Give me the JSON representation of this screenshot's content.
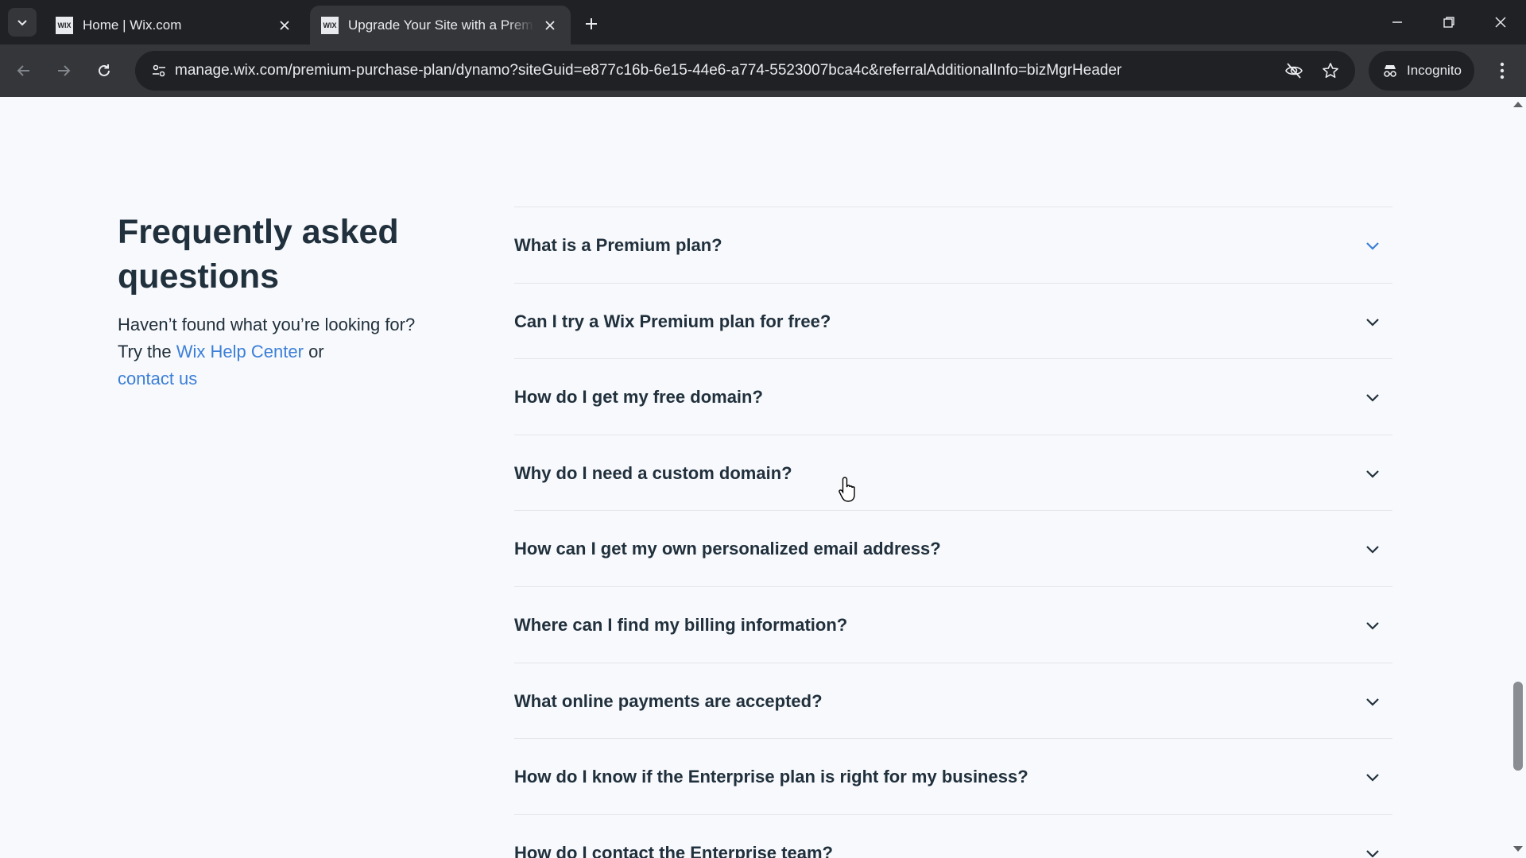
{
  "browser": {
    "tabs": [
      {
        "favicon": "WIX",
        "title": "Home | Wix.com",
        "active": false
      },
      {
        "favicon": "WIX",
        "title": "Upgrade Your Site with a Premium Plan",
        "active": true
      }
    ],
    "url": "manage.wix.com/premium-purchase-plan/dynamo?siteGuid=e877c16b-6e15-44e6-a774-5523007bca4c&referralAdditionalInfo=bizMgrHeader",
    "profile_label": "Incognito"
  },
  "faq": {
    "heading": "Frequently asked questions",
    "sub_prefix": "Haven’t found what you’re looking for? Try the",
    "help_link": "Wix Help Center",
    "sub_or": "or",
    "contact_link": "contact us",
    "items": [
      "What is a Premium plan?",
      "Can I try a Wix Premium plan for free?",
      "How do I get my free domain?",
      "Why do I need a custom domain?",
      "How can I get my own personalized email address?",
      "Where can I find my billing information?",
      "What online payments are accepted?",
      "How do I know if the Enterprise plan is right for my business?",
      "How do I contact the Enterprise team?"
    ]
  },
  "colors": {
    "accent_link": "#3b7fd8",
    "first_chevron": "#3b7fd8",
    "text": "#20303c"
  }
}
